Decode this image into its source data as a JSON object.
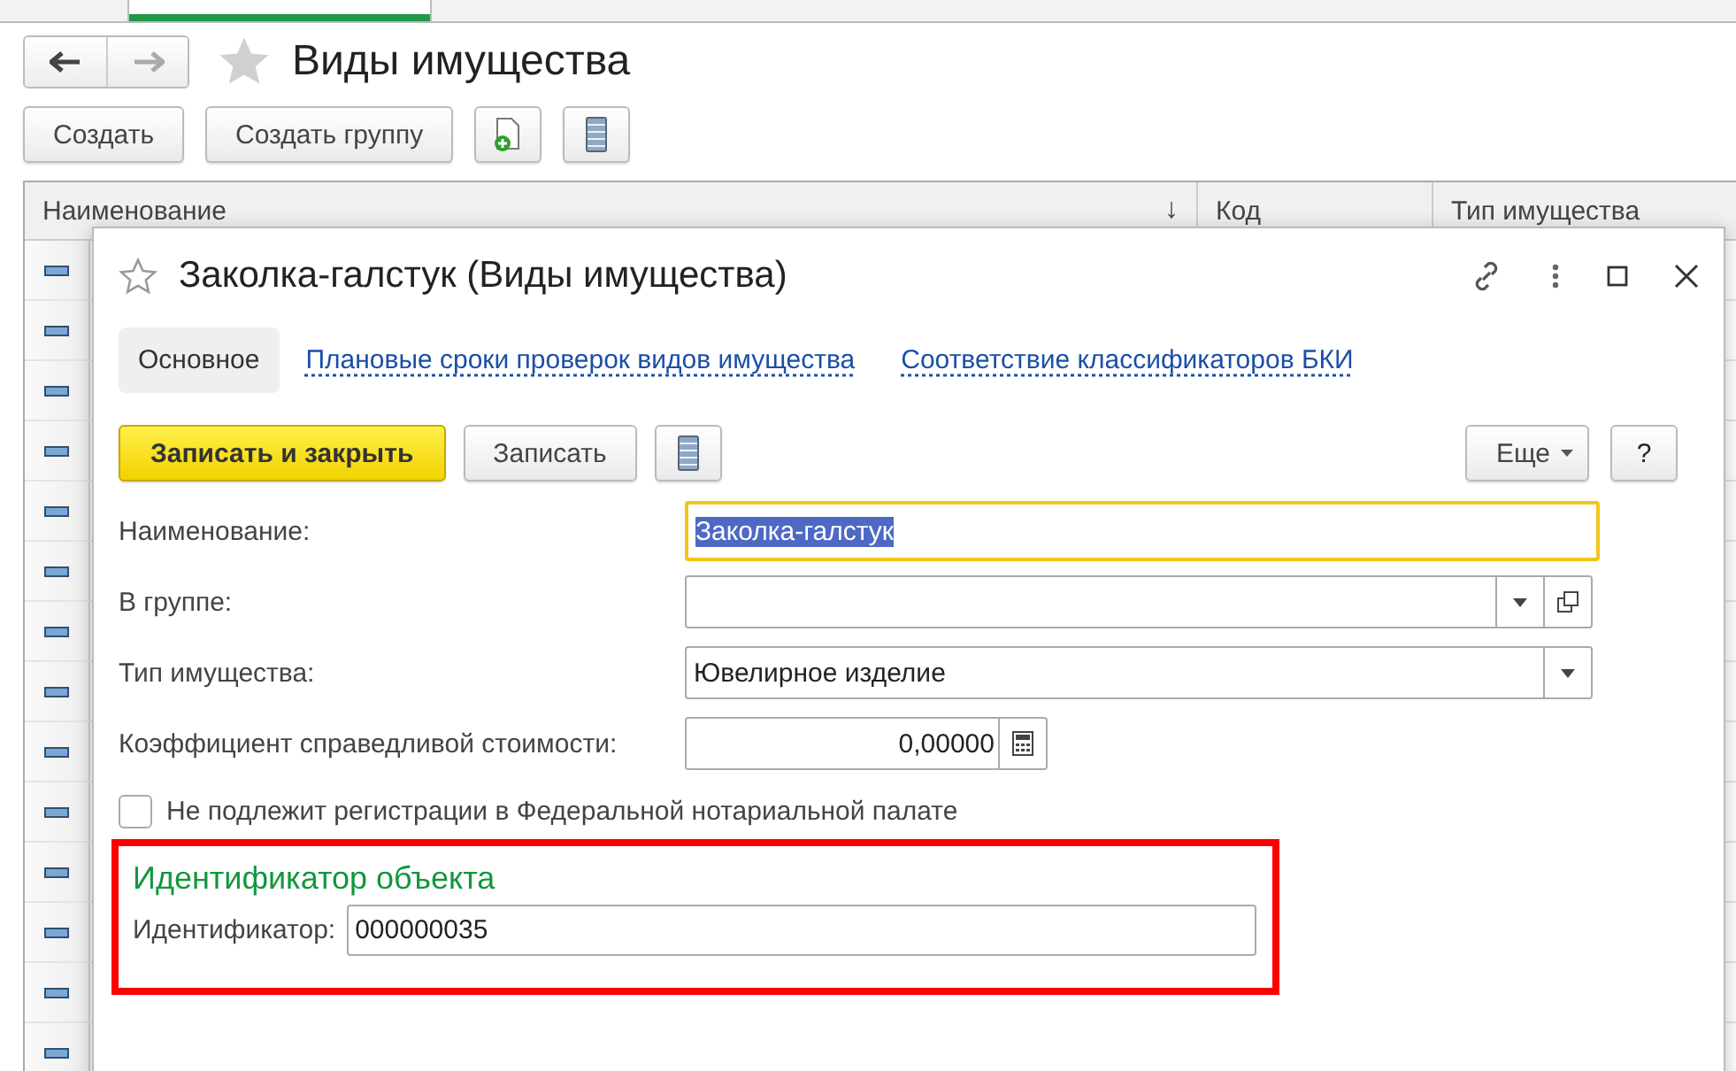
{
  "top_tab": {
    "selected": true
  },
  "window": {
    "title": "Виды имущества"
  },
  "toolbar": {
    "buttons": [
      {
        "kind": "text",
        "label": "Создать"
      },
      {
        "kind": "text",
        "label": "Создать группу"
      },
      {
        "kind": "add-doc"
      },
      {
        "kind": "list"
      }
    ]
  },
  "table": {
    "columns": [
      {
        "label": "Наименование",
        "sort": "↓"
      },
      {
        "label": "Код"
      },
      {
        "label": "Тип имущества"
      }
    ],
    "rows": [
      {
        "kind": "element"
      },
      {
        "kind": "element"
      },
      {
        "kind": "element"
      },
      {
        "kind": "element"
      },
      {
        "kind": "element"
      },
      {
        "kind": "element"
      },
      {
        "kind": "element"
      },
      {
        "kind": "element"
      },
      {
        "kind": "element"
      },
      {
        "kind": "element"
      },
      {
        "kind": "element"
      },
      {
        "kind": "element"
      },
      {
        "kind": "element"
      },
      {
        "kind": "element"
      }
    ]
  },
  "dialog": {
    "title": "Заколка-галстук (Виды имущества)",
    "tabs": [
      {
        "label": "Основное",
        "selected": true
      },
      {
        "label": "Плановые сроки проверок видов имущества",
        "selected": false
      },
      {
        "label": "Соответствие классификаторов БКИ",
        "selected": false
      }
    ],
    "buttons": [
      {
        "kind": "primary",
        "label": "Записать и закрыть"
      },
      {
        "kind": "text",
        "label": "Записать"
      },
      {
        "kind": "list"
      }
    ],
    "more_button": {
      "label": "Еще"
    },
    "help_button": {
      "label": "?"
    },
    "fields": [
      {
        "kind": "text",
        "label": "Наименование:",
        "value": "Заколка-галстук",
        "focused": true
      },
      {
        "kind": "select-open",
        "label": "В группе:",
        "focused": false
      },
      {
        "kind": "select",
        "label": "Тип имущества:",
        "value": "Ювелирное изделие",
        "focused": false
      },
      {
        "kind": "number",
        "label": "Коэффициент справедливой стоимости:",
        "value": "0,00000",
        "focused": false
      }
    ],
    "checkbox": {
      "label": "Не подлежит регистрации в Федеральной нотариальной палате",
      "checked": false
    },
    "group": {
      "title": "Идентификатор объекта",
      "highlighted": true,
      "label": "Идентификатор:",
      "value": "000000035"
    }
  }
}
